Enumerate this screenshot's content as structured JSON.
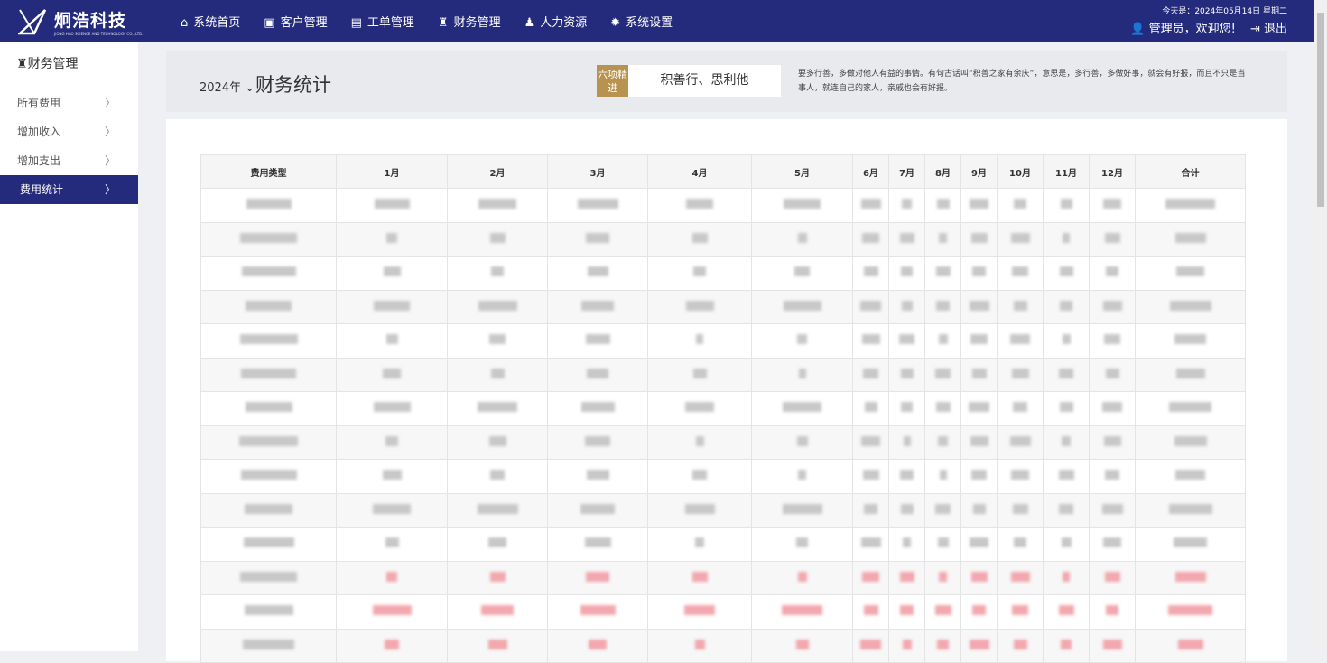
{
  "header": {
    "logo_text": "炯浩科技",
    "logo_sub": "JIONG HAO SCIENCE AND TECHNOLOGY CO., LTD.",
    "nav": [
      {
        "icon": "home-icon",
        "g": "⌂",
        "label": "系统首页"
      },
      {
        "icon": "id-card-icon",
        "g": "▣",
        "label": "客户管理"
      },
      {
        "icon": "file-icon",
        "g": "▤",
        "label": "工单管理"
      },
      {
        "icon": "money-bag-icon",
        "g": "♜",
        "label": "财务管理"
      },
      {
        "icon": "users-icon",
        "g": "♟",
        "label": "人力资源"
      },
      {
        "icon": "gear-icon",
        "g": "✹",
        "label": "系统设置"
      }
    ],
    "date": "今天是：2024年05月14日 星期二",
    "welcome": "管理员，欢迎您!",
    "logout": "退出"
  },
  "sidebar": {
    "title": "财务管理",
    "items": [
      {
        "label": "所有费用"
      },
      {
        "label": "增加收入"
      },
      {
        "label": "增加支出"
      },
      {
        "label": "费用统计",
        "active": true
      }
    ]
  },
  "page": {
    "year": "2024年",
    "title": "财务统计",
    "badge": "六项精进",
    "motto": "积善行、思利他",
    "desc": "要多行善，多做对他人有益的事情。有句古话叫“积善之家有余庆”，意思是，多行善，多做好事，就会有好报，而且不只是当事人，就连自己的家人，亲戚也会有好报。"
  },
  "table": {
    "columns": [
      "费用类型",
      "1月",
      "2月",
      "3月",
      "4月",
      "5月",
      "6月",
      "7月",
      "8月",
      "9月",
      "10月",
      "11月",
      "12月",
      "合计"
    ],
    "row_count": 14,
    "highlight_rows": [
      11,
      12,
      13
    ],
    "highlight_color": "#f2a8ae",
    "values_blurred": true
  },
  "colors": {
    "brand": "#242a7c",
    "badge": "#b8924f"
  }
}
